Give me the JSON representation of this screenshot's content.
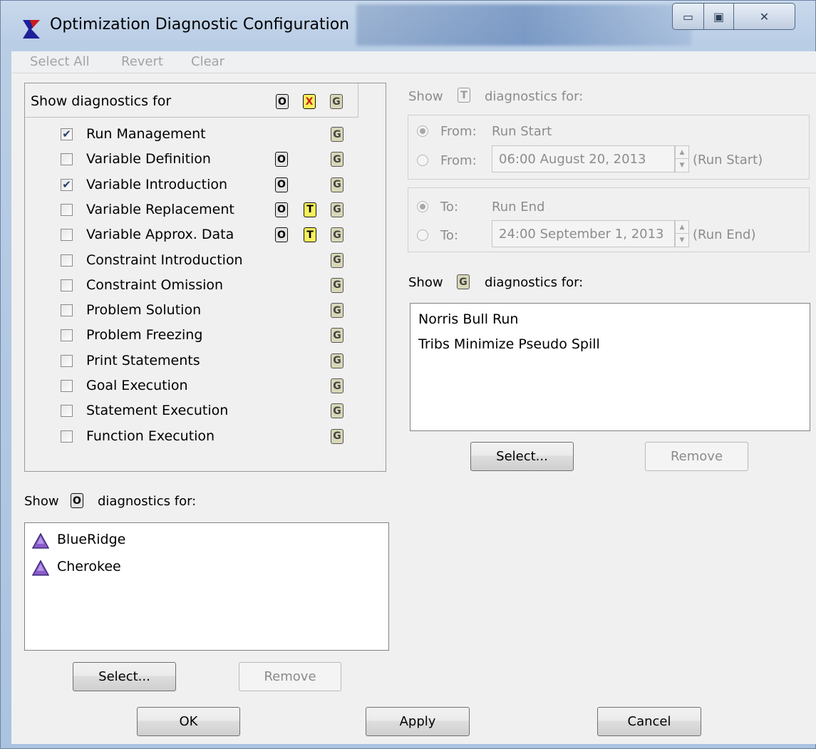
{
  "window": {
    "title": "Optimization Diagnostic Configuration",
    "controls": {
      "minimize": "▭",
      "maximize": "▣",
      "close": "✕"
    }
  },
  "menu": [
    "Select All",
    "Revert",
    "Clear"
  ],
  "diagnostics": {
    "header": "Show diagnostics for",
    "header_badges": [
      "O",
      "X",
      "G"
    ],
    "items": [
      {
        "label": "Run Management",
        "checked": true,
        "badges": [
          "G"
        ]
      },
      {
        "label": "Variable Definition",
        "checked": false,
        "badges": [
          "O",
          "G"
        ]
      },
      {
        "label": "Variable Introduction",
        "checked": true,
        "badges": [
          "O",
          "G"
        ]
      },
      {
        "label": "Variable Replacement",
        "checked": false,
        "badges": [
          "O",
          "T",
          "G"
        ]
      },
      {
        "label": "Variable Approx. Data",
        "checked": false,
        "badges": [
          "O",
          "T",
          "G"
        ]
      },
      {
        "label": "Constraint Introduction",
        "checked": false,
        "badges": [
          "G"
        ]
      },
      {
        "label": "Constraint Omission",
        "checked": false,
        "badges": [
          "G"
        ]
      },
      {
        "label": "Problem Solution",
        "checked": false,
        "badges": [
          "G"
        ]
      },
      {
        "label": "Problem Freezing",
        "checked": false,
        "badges": [
          "G"
        ]
      },
      {
        "label": "Print Statements",
        "checked": false,
        "badges": [
          "G"
        ]
      },
      {
        "label": "Goal Execution",
        "checked": false,
        "badges": [
          "G"
        ]
      },
      {
        "label": "Statement Execution",
        "checked": false,
        "badges": [
          "G"
        ]
      },
      {
        "label": "Function Execution",
        "checked": false,
        "badges": [
          "G"
        ]
      }
    ]
  },
  "objects_section": {
    "show": "Show",
    "badge": "O",
    "suffix": "diagnostics for:",
    "items": [
      "BlueRidge",
      "Cherokee"
    ],
    "select_button": "Select...",
    "remove_button": "Remove"
  },
  "timestep_section": {
    "show": "Show",
    "badge": "T",
    "suffix": "diagnostics for:",
    "from_group": {
      "option1_label": "From:",
      "option1_value": "Run Start",
      "option2_label": "From:",
      "date": "06:00 August 20, 2013",
      "anchor": "(Run Start)"
    },
    "to_group": {
      "option1_label": "To:",
      "option1_value": "Run End",
      "option2_label": "To:",
      "date": "24:00 September 1, 2013",
      "anchor": "(Run End)"
    }
  },
  "goals_section": {
    "show": "Show",
    "badge": "G",
    "suffix": "diagnostics for:",
    "items": [
      "Norris Bull Run",
      "Tribs Minimize Pseudo Spill"
    ],
    "select_button": "Select...",
    "remove_button": "Remove"
  },
  "footer": {
    "ok": "OK",
    "apply": "Apply",
    "cancel": "Cancel"
  },
  "colors": {
    "badge_yellow": "#f7f25b",
    "badge_goal": "#d8d7b7",
    "object_icon": "#8a5cc8",
    "app_icon": "#1e1e9a"
  }
}
